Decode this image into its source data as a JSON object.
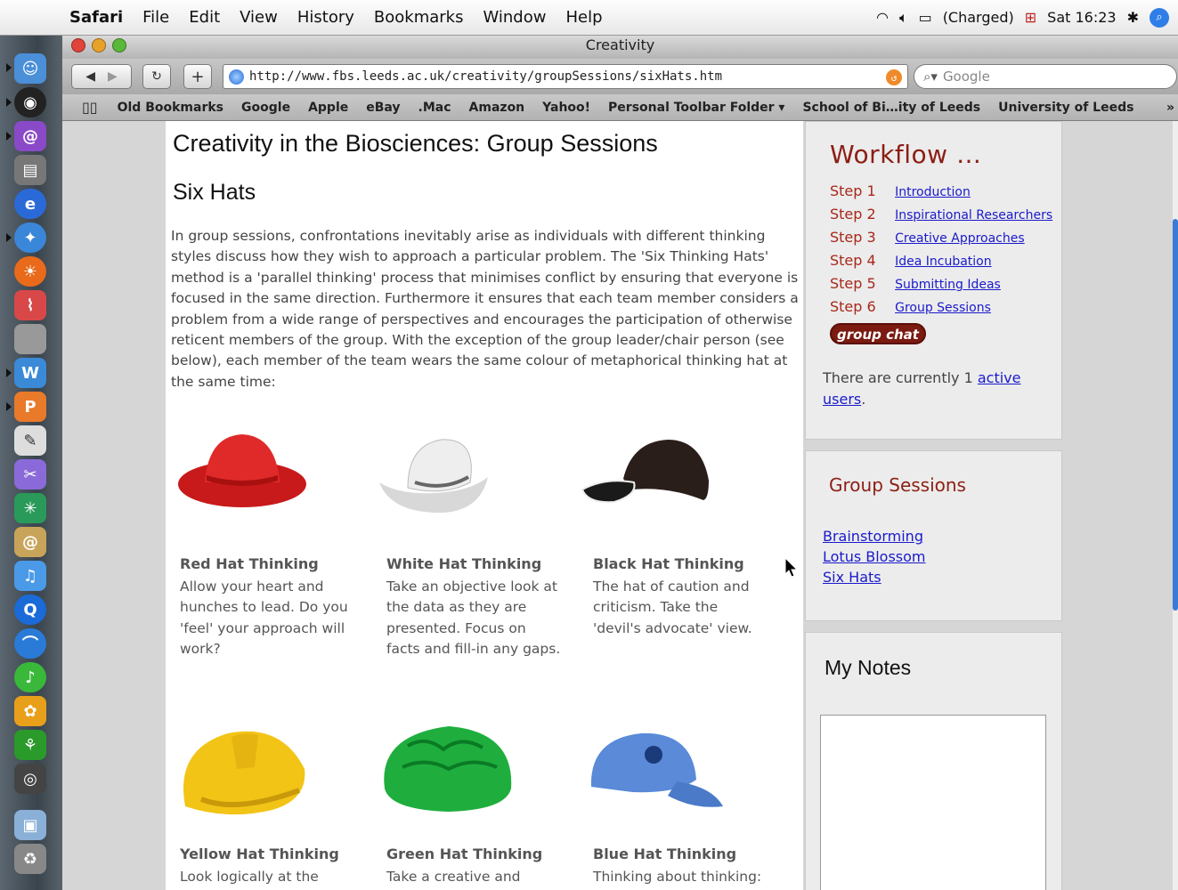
{
  "menubar": {
    "app": "Safari",
    "items": [
      "File",
      "Edit",
      "View",
      "History",
      "Bookmarks",
      "Window",
      "Help"
    ],
    "battery": "(Charged)",
    "clock": "Sat 16:23"
  },
  "window": {
    "title": "Creativity",
    "url": "http://www.fbs.leeds.ac.uk/creativity/groupSessions/sixHats.htm",
    "search_placeholder": "Google",
    "bookmarks": [
      "Old Bookmarks",
      "Google",
      "Apple",
      "eBay",
      ".Mac",
      "Amazon",
      "Yahoo!",
      "Personal Toolbar Folder ▾",
      "School of Bi…ity of Leeds",
      "University of Leeds"
    ]
  },
  "page": {
    "title": "Creativity in the Biosciences: Group Sessions",
    "subtitle": "Six Hats",
    "intro": "In group sessions, confrontations inevitably arise as individuals with different thinking styles discuss how they wish to approach a particular problem. The 'Six Thinking Hats' method is a 'parallel thinking' process that minimises conflict by ensuring that everyone is focused in the same direction. Furthermore it ensures that each team member considers a problem from a wide range of perspectives and encourages the participation of otherwise reticent members of the group. With the exception of the group leader/chair person (see below), each member of the team wears the same colour of metaphorical thinking hat at the same time:",
    "hats": [
      {
        "name": "Red Hat Thinking",
        "desc": "Allow your heart and hunches to lead. Do you 'feel' your approach will work?"
      },
      {
        "name": "White Hat Thinking",
        "desc": "Take an objective look at the data as they are presented.  Focus on facts and fill-in any gaps."
      },
      {
        "name": "Black Hat Thinking",
        "desc": "The hat of caution and criticism. Take the 'devil's advocate' view."
      },
      {
        "name": "Yellow Hat Thinking",
        "desc": "Look logically at the"
      },
      {
        "name": "Green Hat Thinking",
        "desc": "Take a creative and novel"
      },
      {
        "name": "Blue Hat Thinking",
        "desc": "Thinking about thinking:"
      }
    ]
  },
  "sidebar": {
    "workflow_title": "Workflow …",
    "steps": [
      {
        "label": "Step  1",
        "link": "Introduction"
      },
      {
        "label": "Step  2",
        "link": "Inspirational Researchers"
      },
      {
        "label": "Step  3",
        "link": "Creative Approaches"
      },
      {
        "label": "Step  4",
        "link": "Idea Incubation"
      },
      {
        "label": "Step  5",
        "link": "Submitting Ideas"
      },
      {
        "label": "Step  6",
        "link": "Group Sessions"
      }
    ],
    "chat_logo": "group chat",
    "active_prefix": "There are currently 1 ",
    "active_link": "active users",
    "active_suffix": ".",
    "groups_title": "Group Sessions",
    "group_links": [
      "Brainstorming",
      "Lotus Blossom ",
      "Six Hats"
    ],
    "notes_title": "My Notes"
  }
}
